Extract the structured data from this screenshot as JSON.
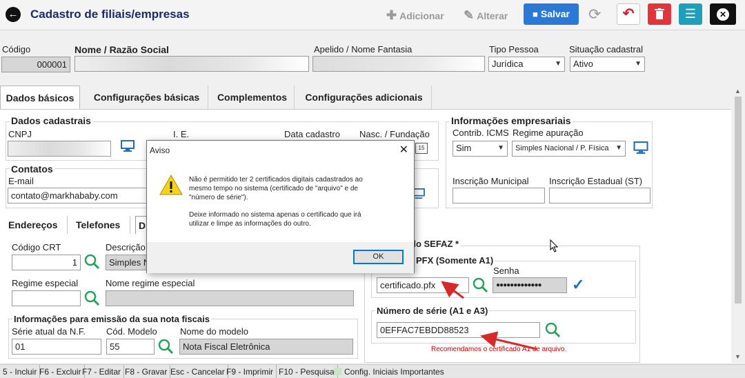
{
  "toolbar": {
    "title": "Cadastro de filiais/empresas",
    "add_label": "Adicionar",
    "edit_label": "Alterar",
    "save_label": "Salvar"
  },
  "header": {
    "codigo_label": "Código",
    "codigo_value": "000001",
    "nome_label": "Nome / Razão Social",
    "nome_value": "",
    "apelido_label": "Apelido / Nome Fantasia",
    "apelido_value": "",
    "tipo_label": "Tipo Pessoa",
    "tipo_value": "Jurídica",
    "situacao_label": "Situação cadastral",
    "situacao_value": "Ativo"
  },
  "tabs": [
    {
      "label": "Dados básicos"
    },
    {
      "label": "Configurações básicas"
    },
    {
      "label": "Complementos"
    },
    {
      "label": "Configurações adicionais"
    }
  ],
  "dados_cadastrais": {
    "title": "Dados cadastrais",
    "cnpj_label": "CNPJ",
    "ie_label": "I. E.",
    "data_cadastro_label": "Data cadastro",
    "nasc_label": "Nasc. / Fundação"
  },
  "contatos": {
    "title": "Contatos",
    "email_label": "E-mail",
    "email_value": "contato@markhababy.com"
  },
  "info_empresariais": {
    "title": "Informações empresariais",
    "contrib_label": "Contrib. ICMS",
    "contrib_value": "Sim",
    "regime_label": "Regime apuração",
    "regime_value": "Simples Nacional / P. Física",
    "insc_mun_label": "Inscrição Municipal",
    "insc_est_label": "Inscrição Estadual (ST)"
  },
  "subtabs": [
    {
      "label": "Endereços"
    },
    {
      "label": "Telefones"
    },
    {
      "label": "D"
    }
  ],
  "fiscal": {
    "crt_label": "Código CRT",
    "crt_value": "1",
    "desc_label": "Descrição",
    "desc_value": "Simples N",
    "regime_esp_label": "Regime especial",
    "nome_regime_label": "Nome regime especial",
    "emissao_title": "Informações para emissão da sua nota fiscais",
    "serie_label": "Série atual da N.F.",
    "serie_value": "01",
    "cod_modelo_label": "Cód. Modelo",
    "cod_modelo_value": "55",
    "nome_modelo_label": "Nome do modelo",
    "nome_modelo_value": "Nota Fiscal Eletrônica"
  },
  "sefaz": {
    "title": "do SEFAZ *",
    "pfx_title": "PFX (Somente A1)",
    "pfx_value": "certificado.pfx",
    "senha_label": "Senha",
    "senha_value": "●●●●●●●●●●●●●",
    "serie_title": "Número de série (A1 e A3)",
    "serie_value": "0EFFAC7EBDD88523",
    "recommendation": "Recomendamos o certificado A1 de arquivo."
  },
  "statusbar": [
    "5 - Incluir",
    "F6 - Excluir",
    "F7 - Editar",
    "F8 - Gravar",
    "Esc - Cancelar",
    "F9 - Imprimir",
    "F10 - Pesquisa",
    "Config. Iniciais Importantes"
  ],
  "dialog": {
    "title": "Aviso",
    "line1": "Não é permitido ter 2 certificados digitais cadastrados ao",
    "line2": "mesmo tempo no sistema (certificado de \"arquivo\" e de",
    "line3": "\"número de série\").",
    "line4": "Deixe informado no sistema apenas o certificado que irá",
    "line5": "utilizar e limpe as informações do outro.",
    "ok_label": "OK"
  },
  "colors": {
    "title": "#1a2a6a",
    "save": "#2a79d6",
    "delete": "#e0353c",
    "menu": "#20a0b8",
    "recommendation": "#cc0000",
    "arrow": "#d42a2a"
  },
  "icons": [
    "back-arrow-icon",
    "plus-icon",
    "pencil-icon",
    "save-disk-icon",
    "refresh-icon",
    "undo-icon",
    "trash-icon",
    "menu-icon",
    "close-icon",
    "computer-icon",
    "search-icon",
    "check-icon",
    "warning-icon",
    "mouse-cursor-icon"
  ]
}
